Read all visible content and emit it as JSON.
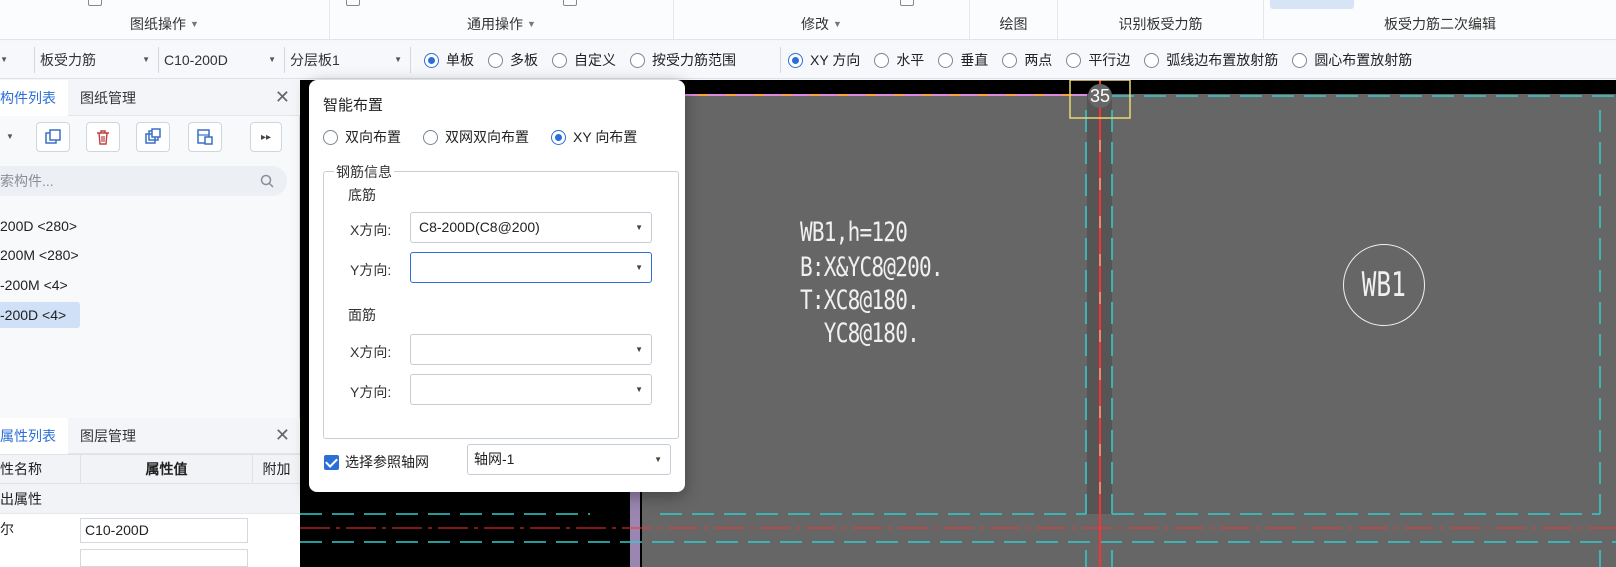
{
  "ribbon": {
    "groups": [
      {
        "label": "图纸操作",
        "dropdown": true
      },
      {
        "label": "通用操作",
        "dropdown": true
      },
      {
        "label": "修改",
        "dropdown": true
      },
      {
        "label": "绘图",
        "dropdown": false
      },
      {
        "label": "识别板受力筋",
        "dropdown": false
      },
      {
        "label": "板受力筋二次编辑",
        "dropdown": false
      }
    ]
  },
  "toolbar": {
    "type_select": "板受力筋",
    "rebar_select": "C10-200D",
    "layer_select": "分层板1",
    "board_mode": [
      {
        "label": "单板",
        "selected": true
      },
      {
        "label": "多板",
        "selected": false
      },
      {
        "label": "自定义",
        "selected": false
      },
      {
        "label": "按受力筋范围",
        "selected": false
      }
    ],
    "direction_mode": [
      {
        "label": "XY 方向",
        "selected": true
      },
      {
        "label": "水平",
        "selected": false
      },
      {
        "label": "垂直",
        "selected": false
      },
      {
        "label": "两点",
        "selected": false
      },
      {
        "label": "平行边",
        "selected": false
      },
      {
        "label": "弧线边布置放射筋",
        "selected": false
      },
      {
        "label": "圆心布置放射筋",
        "selected": false
      }
    ]
  },
  "component_panel": {
    "tabs": [
      "构件列表",
      "图纸管理"
    ],
    "search_placeholder": "索构件...",
    "items": [
      {
        "label": "200D <280>",
        "selected": false
      },
      {
        "label": "200M <280>",
        "selected": false
      },
      {
        "label": "-200M <4>",
        "selected": false
      },
      {
        "label": "-200D <4>",
        "selected": true
      }
    ]
  },
  "property_panel": {
    "tabs": [
      "属性列表",
      "图层管理"
    ],
    "headers": {
      "name": "性名称",
      "value": "属性值",
      "extra": "附加"
    },
    "group": "出属性",
    "rows": [
      {
        "name": "尔",
        "value": "C10-200D"
      }
    ]
  },
  "canvas": {
    "slab_text_lines": [
      "WB1,h=120",
      "B:X&YC8@200.",
      "T:XC8@180.",
      "  YC8@180."
    ],
    "slab_tag": "WB1",
    "axis_number": "35"
  },
  "dialog": {
    "title": "智能布置",
    "layout_modes": [
      {
        "label": "双向布置",
        "selected": false
      },
      {
        "label": "双网双向布置",
        "selected": false
      },
      {
        "label": "XY 向布置",
        "selected": true
      }
    ],
    "rebar_info_legend": "钢筋信息",
    "bottom_label": "底筋",
    "top_label": "面筋",
    "x_label": "X方向:",
    "y_label": "Y方向:",
    "bottom_x_value": "C8-200D(C8@200)",
    "bottom_y_value": "",
    "top_x_value": "",
    "top_y_value": "",
    "ref_axis_label": "选择参照轴网",
    "ref_axis_checked": true,
    "ref_axis_value": "轴网-1"
  },
  "colors": {
    "accent": "#2b6fd6",
    "canvas_bg": "#000000",
    "slab_fill": "#666666",
    "cyan_line": "#33cccc",
    "red_line": "#ff3030"
  }
}
